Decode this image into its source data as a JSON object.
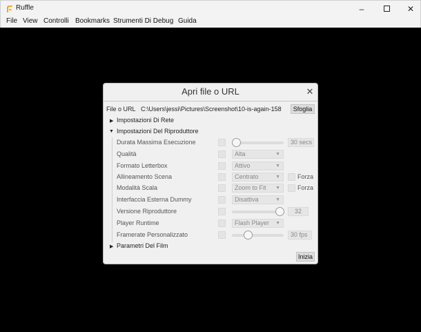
{
  "window": {
    "title": "Ruffle",
    "brand_color": "#f5a623"
  },
  "menu": [
    "File",
    "View",
    "Controlli",
    "Bookmarks",
    "Strumenti Di Debug",
    "Guida"
  ],
  "dialog": {
    "title": "Apri file o URL",
    "file_label": "File o URL",
    "file_value": "C:\\Users\\jessi\\Pictures\\Screenshot\\10-is-again-158",
    "browse_label": "Sfoglia",
    "network_section": "Impostazioni Di Rete",
    "player_section": "Impostazioni Del Riproduttore",
    "movie_section": "Parametri Del Film",
    "start_label": "Inizia",
    "rows": {
      "max_duration": {
        "label": "Durata Massima Esecuzione",
        "value": "30",
        "unit": "secs"
      },
      "quality": {
        "label": "Qualità",
        "value": "Alta"
      },
      "letterbox": {
        "label": "Formato Letterbox",
        "value": "Attivo"
      },
      "stage_align": {
        "label": "Allineamento Scena",
        "value": "Centrato",
        "force_label": "Forza"
      },
      "scale_mode": {
        "label": "Modalità Scala",
        "value": "Zoom to Fit",
        "force_label": "Forza"
      },
      "dummy_interface": {
        "label": "Interfaccia Esterna Dummy",
        "value": "Disattiva"
      },
      "player_version": {
        "label": "Versione Riproduttore",
        "value": "32"
      },
      "player_runtime": {
        "label": "Player Runtime",
        "value": "Flash Player"
      },
      "custom_framerate": {
        "label": "Framerate Personalizzato",
        "value": "30",
        "unit": "fps"
      }
    }
  }
}
